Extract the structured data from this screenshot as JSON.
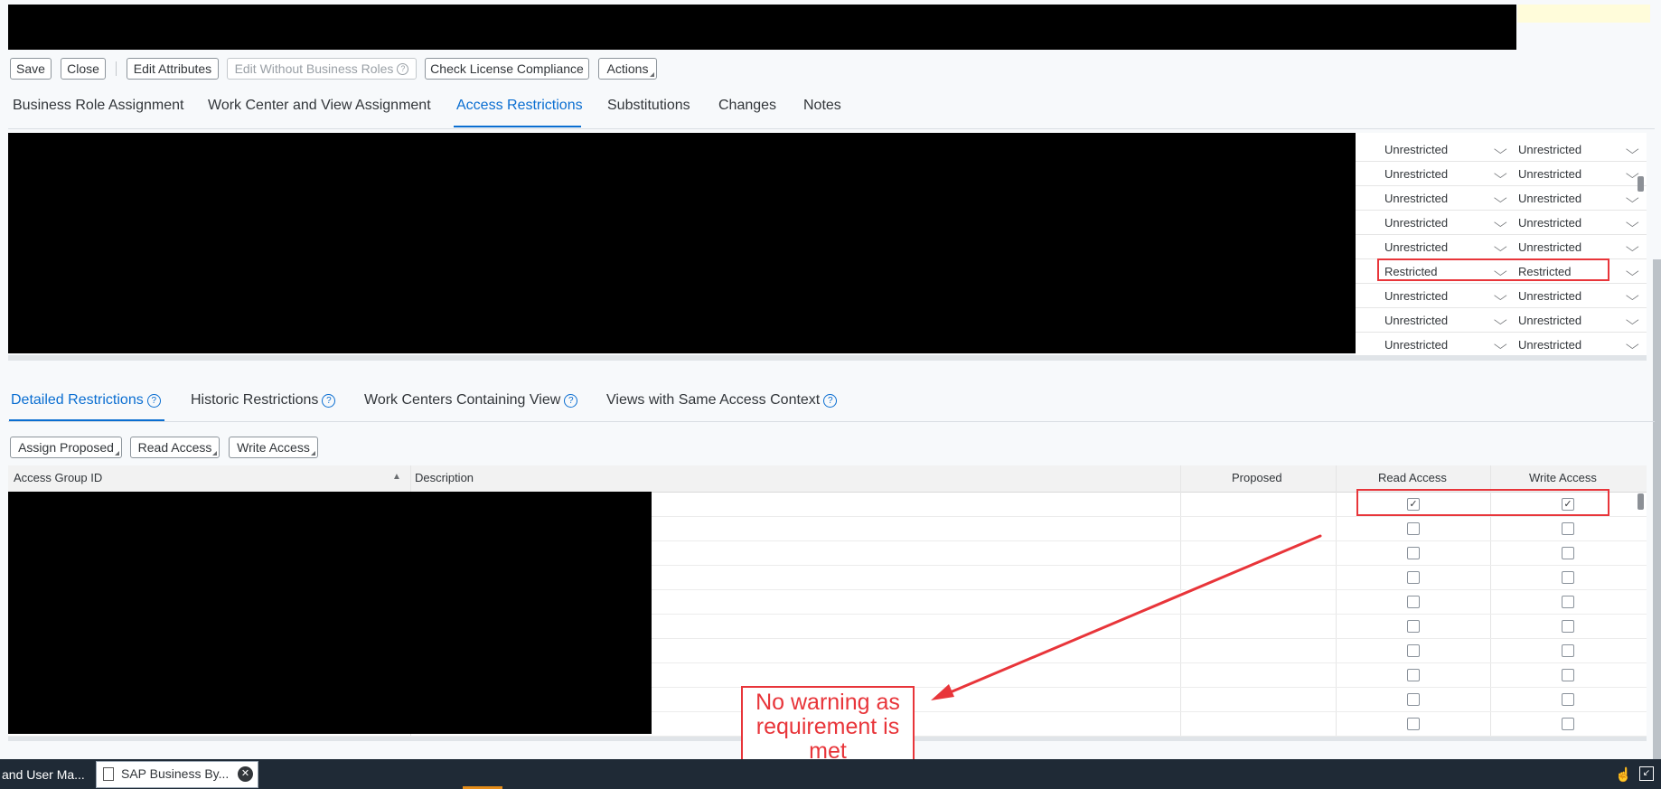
{
  "toolbar": {
    "save": "Save",
    "close": "Close",
    "edit_attributes": "Edit Attributes",
    "edit_without_business_roles": "Edit Without Business Roles",
    "check_license_compliance": "Check License Compliance",
    "actions": "Actions"
  },
  "main_tabs": [
    "Business Role Assignment",
    "Work Center and View Assignment",
    "Access Restrictions",
    "Substitutions",
    "Changes",
    "Notes"
  ],
  "main_tab_active": "Access Restrictions",
  "upper_table": {
    "rows": [
      {
        "read": "Unrestricted",
        "write": "Unrestricted"
      },
      {
        "read": "Unrestricted",
        "write": "Unrestricted"
      },
      {
        "read": "Unrestricted",
        "write": "Unrestricted"
      },
      {
        "read": "Unrestricted",
        "write": "Unrestricted"
      },
      {
        "read": "Unrestricted",
        "write": "Unrestricted"
      },
      {
        "read": "Restricted",
        "write": "Restricted"
      },
      {
        "read": "Unrestricted",
        "write": "Unrestricted"
      },
      {
        "read": "Unrestricted",
        "write": "Unrestricted"
      },
      {
        "read": "Unrestricted",
        "write": "Unrestricted"
      }
    ]
  },
  "detail_tabs": [
    "Detailed Restrictions",
    "Historic Restrictions",
    "Work Centers Containing View",
    "Views with Same Access Context"
  ],
  "detail_tab_active": "Detailed Restrictions",
  "detail_buttons": {
    "assign_proposed": "Assign Proposed",
    "read_access": "Read Access",
    "write_access": "Write Access"
  },
  "lower_table": {
    "columns": {
      "access_group_id": "Access Group ID",
      "description": "Description",
      "proposed": "Proposed",
      "read_access": "Read Access",
      "write_access": "Write Access"
    },
    "rows": [
      {
        "read": true,
        "write": true
      },
      {
        "read": false,
        "write": false
      },
      {
        "read": false,
        "write": false
      },
      {
        "read": false,
        "write": false
      },
      {
        "read": false,
        "write": false
      },
      {
        "read": false,
        "write": false
      },
      {
        "read": false,
        "write": false
      },
      {
        "read": false,
        "write": false
      },
      {
        "read": false,
        "write": false
      },
      {
        "read": false,
        "write": false
      }
    ]
  },
  "annotation": {
    "note": "No warning as requirement is met",
    "color": "#e8353a"
  },
  "taskbar": {
    "left_item": "and User Ma...",
    "tab_label": "SAP Business By..."
  },
  "colors": {
    "accent": "#0a6ed1",
    "taskbar": "#1f2a36"
  }
}
